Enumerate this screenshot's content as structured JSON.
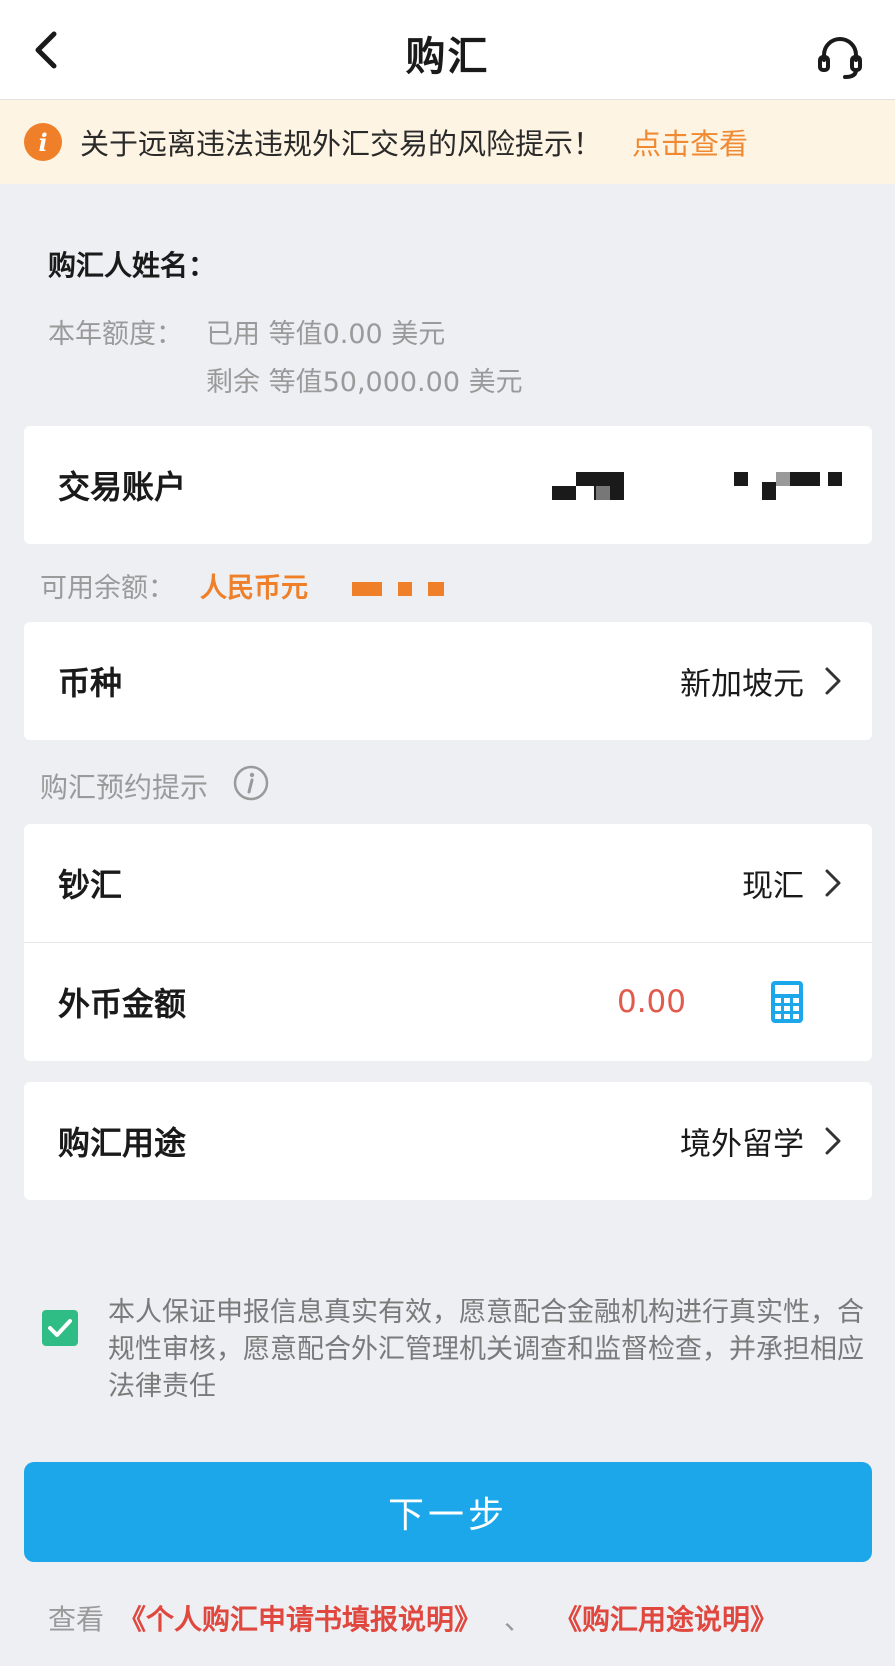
{
  "header": {
    "title": "购汇",
    "back_icon": "chevron-left-icon",
    "service_icon": "headset-icon"
  },
  "notice": {
    "text": "关于远离违法违规外汇交易的风险提示！",
    "link": "点击查看",
    "icon": "info-icon",
    "accent_color": "#ef7f28"
  },
  "buyer": {
    "name_label": "购汇人姓名："
  },
  "quota": {
    "label": "本年额度：",
    "used": "已用 等值0.00 美元",
    "remaining": "剩余 等值50,000.00 美元"
  },
  "account": {
    "label": "交易账户"
  },
  "balance": {
    "label": "可用余额：",
    "currency": "人民币元"
  },
  "currency": {
    "label": "币种",
    "value": "新加坡元"
  },
  "appointment": {
    "hint": "购汇预约提示"
  },
  "cash_remit": {
    "label": "钞汇",
    "value": "现汇"
  },
  "amount": {
    "label": "外币金额",
    "value": "0.00",
    "calculator_icon": "calculator-icon"
  },
  "purpose": {
    "label": "购汇用途",
    "value": "境外留学"
  },
  "agreement": {
    "checked": true,
    "text": "本人保证申报信息真实有效，愿意配合金融机构进行真实性，合规性审核，愿意配合外汇管理机关调查和监督检查，并承担相应法律责任"
  },
  "next_button": {
    "label": "下一步",
    "color": "#1ba7ea"
  },
  "footer": {
    "view_label": "查看",
    "link1": "《个人购汇申请书填报说明》",
    "separator": "、",
    "link2": "《购汇用途说明》"
  }
}
